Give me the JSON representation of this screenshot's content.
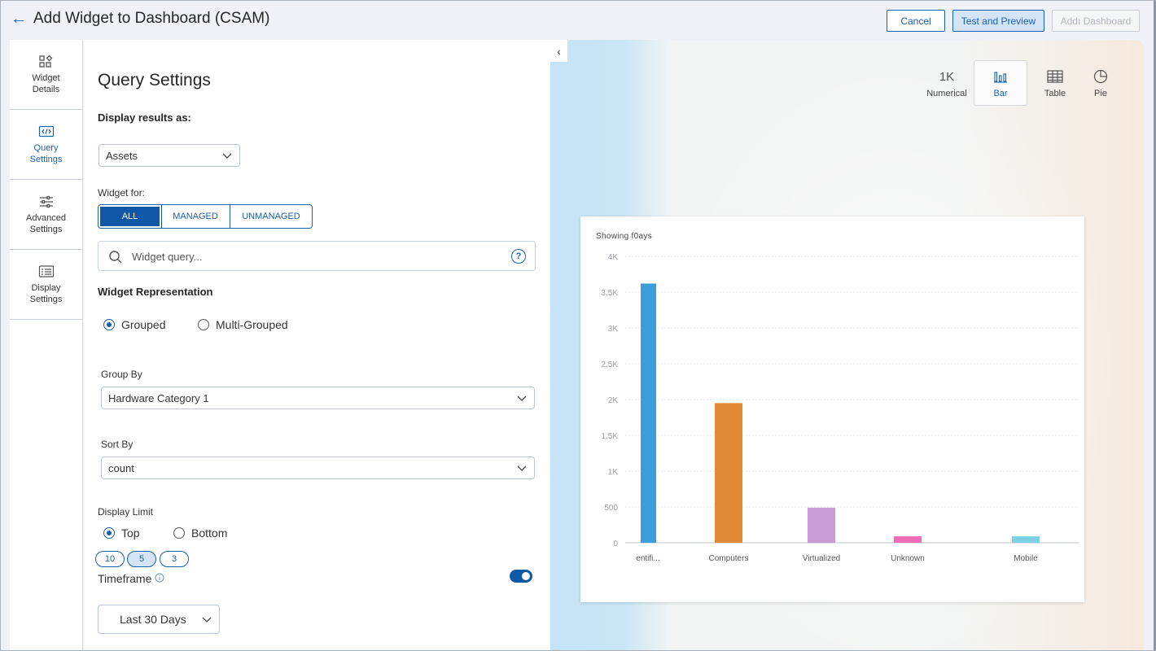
{
  "header": {
    "back_icon": "arrow-left-icon",
    "title": "Add Widget to Dashboard (CSAM)",
    "cancel_label": "Cancel",
    "preview_label": "Test and Preview",
    "add_label": "Addı Dashboard"
  },
  "sidebar": {
    "items": [
      {
        "label_1": "Widget",
        "label_2": "Details",
        "icon": "widget-shapes-icon"
      },
      {
        "label_1": "Query",
        "label_2": "Settings",
        "icon": "code-icon"
      },
      {
        "label_1": "Advanced",
        "label_2": "Settings",
        "icon": "sliders-icon"
      },
      {
        "label_1": "Display",
        "label_2": "Settings",
        "icon": "display-list-icon"
      }
    ]
  },
  "query": {
    "title": "Query Settings",
    "display_results_label": "Display results as:",
    "display_results_value": "Assets",
    "widget_for_label": "Widget for:",
    "widget_for_options": [
      "ALL",
      "MANAGED",
      "UNMANAGED"
    ],
    "widget_for_selected": "ALL",
    "search_placeholder": "Widget query...",
    "help_glyph": "?",
    "representation_label": "Widget Representation",
    "representation_options": [
      "Grouped",
      "Multi-Grouped"
    ],
    "representation_selected": "Grouped",
    "group_by_label": "Group By",
    "group_by_value": "Hardware Category 1",
    "sort_by_label": "Sort By",
    "sort_by_value": "count",
    "display_limit_label": "Display Limit",
    "display_limit_options": [
      "Top",
      "Bottom"
    ],
    "display_limit_selected": "Top",
    "limit_pills": [
      "10",
      "5",
      "3"
    ],
    "limit_selected": "5",
    "timeframe_label": "Timeframe",
    "timeframe_enabled": true,
    "timeframe_value": "Last 30 Days"
  },
  "visualization": {
    "types": [
      {
        "label": "Numerical",
        "glyph": "1K"
      },
      {
        "label": "Bar",
        "glyph": "",
        "icon": "bar-chart-icon"
      },
      {
        "label": "Table",
        "glyph": "",
        "icon": "table-icon"
      },
      {
        "label": "Pie",
        "glyph": "",
        "icon": "pie-chart-icon"
      }
    ],
    "selected": "Bar"
  },
  "chart_data": {
    "type": "bar",
    "title": "Showing f0ays",
    "categories": [
      "entifi...",
      "Computers",
      "Virtualized",
      "Unknown",
      "Mobile"
    ],
    "values": [
      3620,
      1950,
      490,
      90,
      90
    ],
    "colors": [
      "#3a9fd8",
      "#e08a36",
      "#c99ad6",
      "#f06cb4",
      "#7dd0e6"
    ],
    "yticks": [
      "0",
      "500",
      "1K",
      "1.5K",
      "2K",
      "2.5K",
      "3K",
      "3.5K",
      "4K"
    ],
    "ylim": [
      0,
      4000
    ],
    "grid": true
  }
}
